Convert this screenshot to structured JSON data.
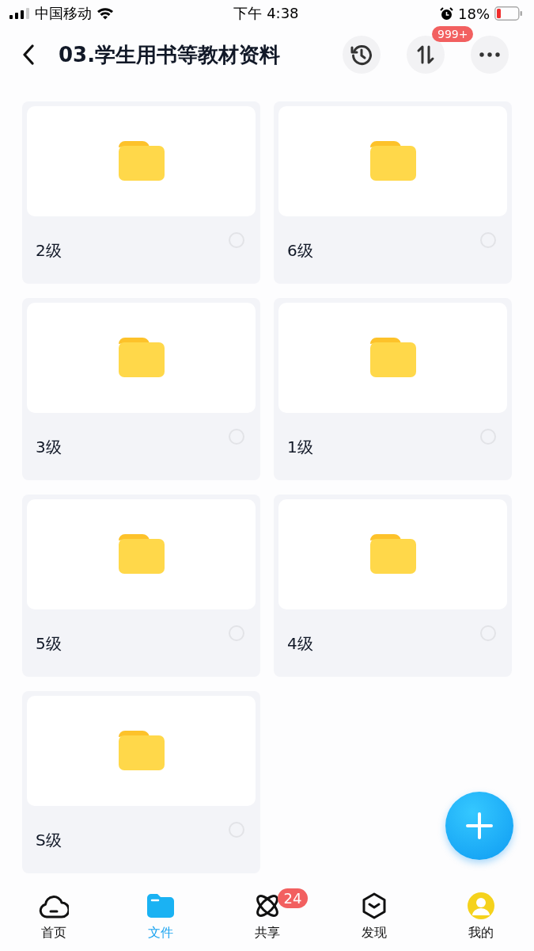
{
  "status_bar": {
    "carrier": "中国移动",
    "time": "下午 4:38",
    "battery": "18%"
  },
  "header": {
    "title": "03.学生用书等教材资料",
    "badge": "999+"
  },
  "folders": [
    {
      "name": "2级",
      "selected": false
    },
    {
      "name": "6级",
      "selected": false
    },
    {
      "name": "3级",
      "selected": false
    },
    {
      "name": "1级",
      "selected": false
    },
    {
      "name": "5级",
      "selected": false
    },
    {
      "name": "4级",
      "selected": false
    },
    {
      "name": "S级",
      "selected": false
    }
  ],
  "tabs": [
    {
      "label": "首页",
      "selected": false
    },
    {
      "label": "文件",
      "selected": true
    },
    {
      "label": "共享",
      "selected": false,
      "badge": "24"
    },
    {
      "label": "发现",
      "selected": false
    },
    {
      "label": "我的",
      "selected": false
    }
  ]
}
